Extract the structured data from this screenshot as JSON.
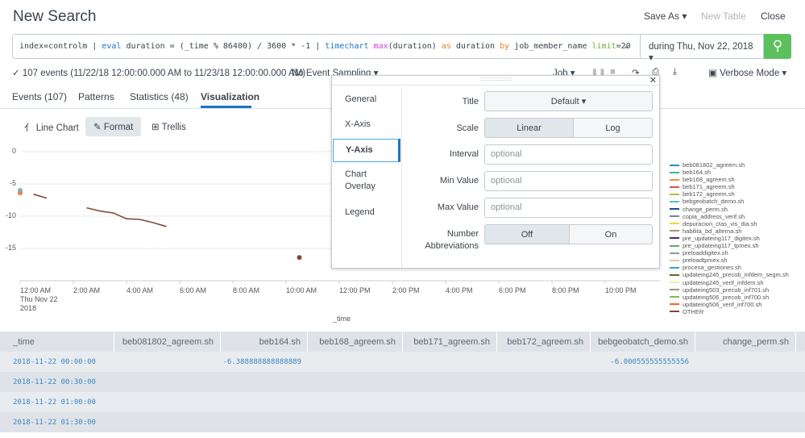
{
  "header": {
    "title": "New Search",
    "save_as": "Save As ▾",
    "new_table": "New Table",
    "close": "Close"
  },
  "search": {
    "parts": [
      "index=controlm | ",
      "eval",
      " duration = (_time % 86400) / 3600 * -1 | ",
      "timechart",
      " ",
      "max",
      "(duration) ",
      "as",
      " duration ",
      "by",
      " job_member_name ",
      "limit",
      "=20"
    ],
    "time_picker": "during Thu, Nov 22, 2018 ▾",
    "search_icon": "magnifier-icon"
  },
  "status": {
    "events": "✓ 107 events (11/22/18 12:00:00.000 AM to 11/23/18 12:00:00.000 AM)",
    "sampling": "No Event Sampling ▾",
    "job": "Job ▾",
    "mode": "Verbose Mode ▾"
  },
  "tabs": [
    {
      "label": "Events (107)"
    },
    {
      "label": "Patterns"
    },
    {
      "label": "Statistics (48)"
    },
    {
      "label": "Visualization",
      "active": true
    }
  ],
  "viz_toolbar": {
    "chart_type": "Line Chart",
    "format": "Format",
    "trellis": "Trellis"
  },
  "chart_data": {
    "type": "line",
    "xlabel": "_time",
    "ylim": [
      -20,
      0
    ],
    "yticks": [
      "0",
      "-5",
      "-10",
      "-15"
    ],
    "xticks": [
      "12:00 AM\nThu Nov 22\n2018",
      "2:00 AM",
      "4:00 AM",
      "6:00 AM",
      "8:00 AM",
      "10:00 AM",
      "12:00 PM",
      "2:00 PM",
      "4:00 PM",
      "6:00 PM",
      "8:00 PM",
      "10:00 PM"
    ],
    "series": [
      {
        "name": "beb164.sh",
        "color": "#5fb9a5",
        "points": [
          [
            "00:00",
            -6.388888888888889
          ]
        ]
      },
      {
        "name": "bebgeobatch_demo.sh",
        "color": "#5fc0c7",
        "points": [
          [
            "00:00",
            -6.000555555555556
          ]
        ]
      },
      {
        "name": "beb168_agreem.sh",
        "color": "#e9835c",
        "points": [
          [
            "00:00",
            -6.4
          ]
        ]
      },
      {
        "name": "OTHER",
        "color": "#7d4a3a",
        "points": [
          [
            "00:30",
            -6.6
          ],
          [
            "01:00",
            -7.2
          ],
          [
            "02:30",
            -8.7
          ],
          [
            "03:00",
            -9.2
          ],
          [
            "03:30",
            -9.5
          ],
          [
            "04:00",
            -10.4
          ],
          [
            "04:30",
            -10.5
          ],
          [
            "05:00",
            -11.0
          ],
          [
            "05:30",
            -11.6
          ],
          [
            "10:30",
            -16.4
          ]
        ]
      }
    ],
    "legend_position": "right",
    "legend": [
      {
        "name": "beb081802_agreem.sh",
        "color": "#1e93c6"
      },
      {
        "name": "beb164.sh",
        "color": "#3cb4a0"
      },
      {
        "name": "beb168_agreem.sh",
        "color": "#f58f39"
      },
      {
        "name": "beb171_agreem.sh",
        "color": "#d6563c"
      },
      {
        "name": "beb172_agreem.sh",
        "color": "#a8c83c"
      },
      {
        "name": "bebgeobatch_demo.sh",
        "color": "#5fc0c7"
      },
      {
        "name": "change_perm.sh",
        "color": "#1b4f7a"
      },
      {
        "name": "copia_address_verif.sh",
        "color": "#708794"
      },
      {
        "name": "depuracion_ctas_vis_dia.sh",
        "color": "#f7d33c"
      },
      {
        "name": "habilita_bd_alterna.sh",
        "color": "#b89070"
      },
      {
        "name": "pre_updateing117_digitex.sh",
        "color": "#4a2c6e"
      },
      {
        "name": "pre_updateing117_tpmex.sh",
        "color": "#6ba36b"
      },
      {
        "name": "preloaddigitex.sh",
        "color": "#8a9aa6"
      },
      {
        "name": "preloadtpmex.sh",
        "color": "#e0c9b5"
      },
      {
        "name": "procesa_gestiones.sh",
        "color": "#31a5c6"
      },
      {
        "name": "updateing245_precob_infdem_segm.sh",
        "color": "#5a6d2b"
      },
      {
        "name": "updateing245_verif_infdem.sh",
        "color": "#f3e9a4"
      },
      {
        "name": "updateing503_precob_inf701.sh",
        "color": "#9b9680"
      },
      {
        "name": "updateing506_precob_inf700.sh",
        "color": "#7cc05a"
      },
      {
        "name": "updateing506_verif_inf700.sh",
        "color": "#f0672c"
      },
      {
        "name": "OTHER",
        "color": "#7d4a3a"
      }
    ]
  },
  "format_panel": {
    "nav": [
      "General",
      "X-Axis",
      "Y-Axis",
      "Chart\nOverlay",
      "Legend"
    ],
    "selected": "Y-Axis",
    "title_label": "Title",
    "title_value": "Default ▾",
    "scale_label": "Scale",
    "scale_options": [
      "Linear",
      "Log"
    ],
    "scale_selected": "Linear",
    "interval_label": "Interval",
    "min_label": "Min Value",
    "max_label": "Max Value",
    "placeholder": "optional",
    "abbr_label": "Number\nAbbreviations",
    "abbr_options": [
      "Off",
      "On"
    ],
    "abbr_selected": "Off"
  },
  "table": {
    "columns": [
      "_time",
      "beb081802_agreem.sh",
      "beb164.sh",
      "beb168_agreem.sh",
      "beb171_agreem.sh",
      "beb172_agreem.sh",
      "bebgeobatch_demo.sh",
      "change_perm.sh"
    ],
    "rows": [
      [
        "2018-11-22 00:00:00",
        "",
        "-6.388888888888889",
        "",
        "",
        "",
        "-6.000555555555556",
        ""
      ],
      [
        "2018-11-22 00:30:00",
        "",
        "",
        "",
        "",
        "",
        "",
        ""
      ],
      [
        "2018-11-22 01:00:00",
        "",
        "",
        "",
        "",
        "",
        "",
        ""
      ],
      [
        "2018-11-22 01:30:00",
        "",
        "",
        "",
        "",
        "",
        "",
        ""
      ]
    ]
  }
}
